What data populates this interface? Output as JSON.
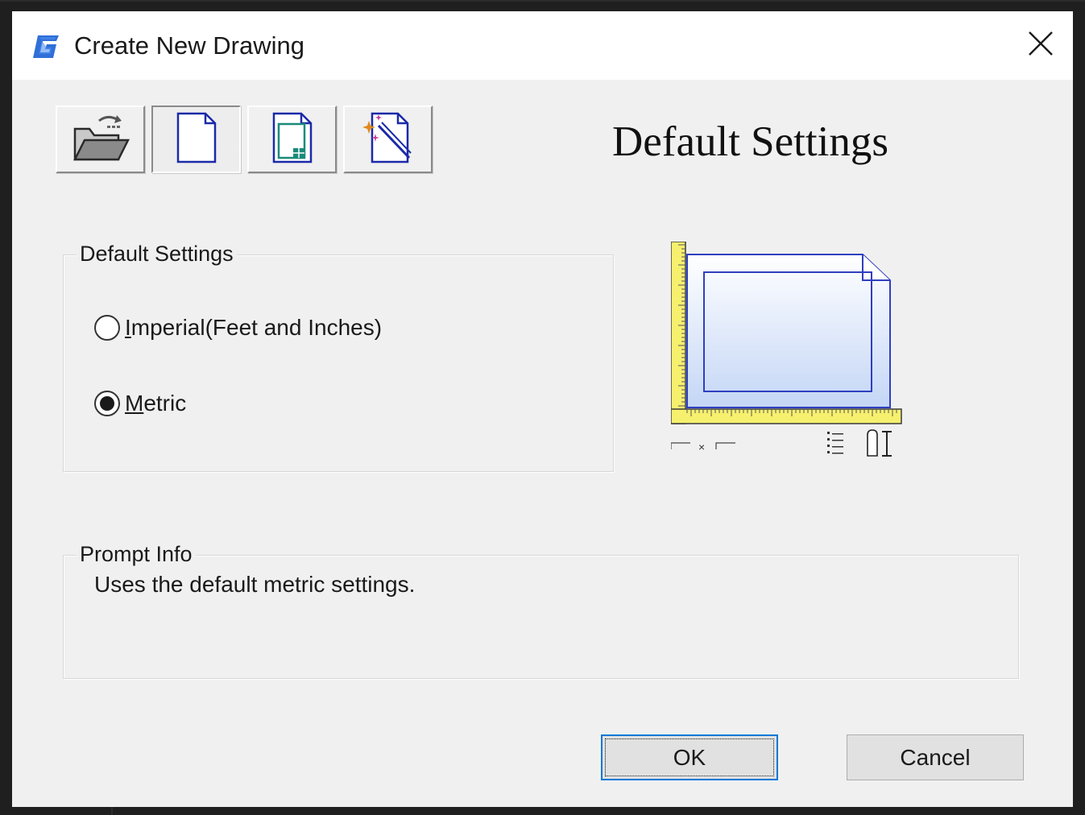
{
  "window": {
    "title": "Create New Drawing",
    "app_icon": "gstarcad-logo-icon",
    "close_icon": "close-icon"
  },
  "toolbar": {
    "buttons": [
      {
        "name": "open-drawing",
        "icon": "folder-open-icon",
        "pressed": false
      },
      {
        "name": "default-settings",
        "icon": "blank-page-icon",
        "pressed": true
      },
      {
        "name": "use-template",
        "icon": "template-page-icon",
        "pressed": false
      },
      {
        "name": "use-wizard",
        "icon": "wizard-page-icon",
        "pressed": false
      }
    ]
  },
  "heading": "Default Settings",
  "settings_group": {
    "legend": "Default Settings",
    "options": [
      {
        "mnemonic": "I",
        "rest": "mperial(Feet and Inches)",
        "selected": false
      },
      {
        "mnemonic": "M",
        "rest": "etric",
        "selected": true
      }
    ]
  },
  "prompt_group": {
    "legend": "Prompt Info",
    "text": "Uses the default metric settings."
  },
  "buttons": {
    "ok": "OK",
    "cancel": "Cancel"
  },
  "colors": {
    "accent": "#0078d7",
    "ruler_yellow": "#f6f06e",
    "page_outline": "#2f3fbf",
    "dialog_bg": "#f0f0f0"
  }
}
